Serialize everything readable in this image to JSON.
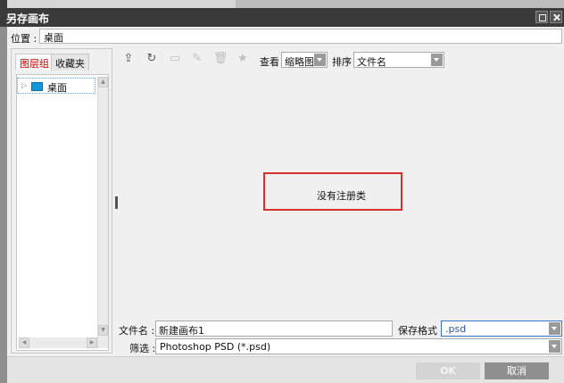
{
  "window": {
    "title": "另存画布"
  },
  "location": {
    "label": "位置 :",
    "value": "桌面"
  },
  "left_panel": {
    "tabs": [
      {
        "label": "图层组",
        "active": true
      },
      {
        "label": "收藏夹",
        "active": false
      }
    ],
    "tree": [
      {
        "label": "桌面",
        "icon": "folder-icon"
      }
    ]
  },
  "toolbar": {
    "icons": [
      "up-folder-icon",
      "refresh-icon",
      "new-folder-icon",
      "edit-icon",
      "trash-icon",
      "star-icon"
    ],
    "view_label": "查看",
    "view_value": "缩略图",
    "sort_label": "排序",
    "sort_value": "文件名"
  },
  "main": {
    "empty_message": "没有注册类"
  },
  "bottom": {
    "filename_label": "文件名 :",
    "filename_value": "新建画布1",
    "format_label": "保存格式 :",
    "format_value": ".psd",
    "filter_label": "筛选 :",
    "filter_value": "Photoshop PSD (*.psd)",
    "ok_label": "OK",
    "cancel_label": "取消"
  },
  "colors": {
    "titlebar": "#3a3a3a",
    "active_tab_text": "#d00000",
    "highlight_border": "#d9302c",
    "folder": "#1596d8",
    "cancel_button": "#8f8f8f"
  }
}
